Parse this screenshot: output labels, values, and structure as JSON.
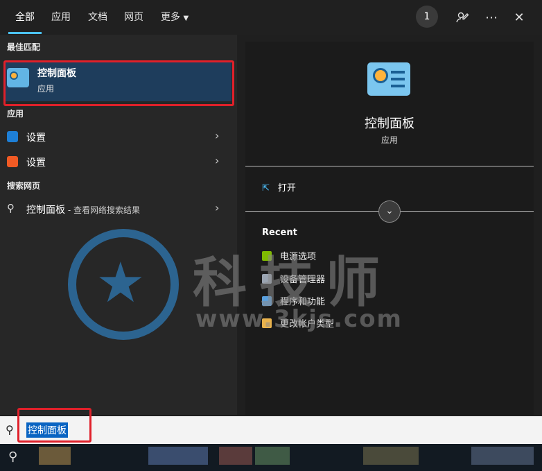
{
  "tabs": [
    "全部",
    "应用",
    "文档",
    "网页",
    "更多"
  ],
  "header": {
    "badge": "1"
  },
  "left": {
    "best_match_title": "最佳匹配",
    "best_match": {
      "title": "控制面板",
      "subtitle": "应用"
    },
    "apps_title": "应用",
    "apps": [
      {
        "label": "设置",
        "icon": "gear-icon",
        "color": "#1e7fd6"
      },
      {
        "label": "设置",
        "icon": "sogou-icon",
        "color": "#f15a24"
      }
    ],
    "web_title": "搜索网页",
    "web": {
      "label": "控制面板",
      "sub": " - 查看网络搜索结果"
    }
  },
  "right": {
    "title": "控制面板",
    "subtitle": "应用",
    "open_label": "打开",
    "recent_title": "Recent",
    "recent": [
      {
        "label": "电源选项",
        "color": "#7fba00"
      },
      {
        "label": "设备管理器",
        "color": "#9aa4b1"
      },
      {
        "label": "程序和功能",
        "color": "#5aa0de"
      },
      {
        "label": "更改帐户类型",
        "color": "#e9b24c"
      }
    ]
  },
  "watermark": {
    "text": "科技师",
    "url": "www.3kjs.com"
  },
  "search": {
    "query": "控制面板"
  },
  "colors": {
    "accent": "#4cc2ff",
    "selection": "#1e3d5c",
    "highlight_box": "#e0202a"
  }
}
